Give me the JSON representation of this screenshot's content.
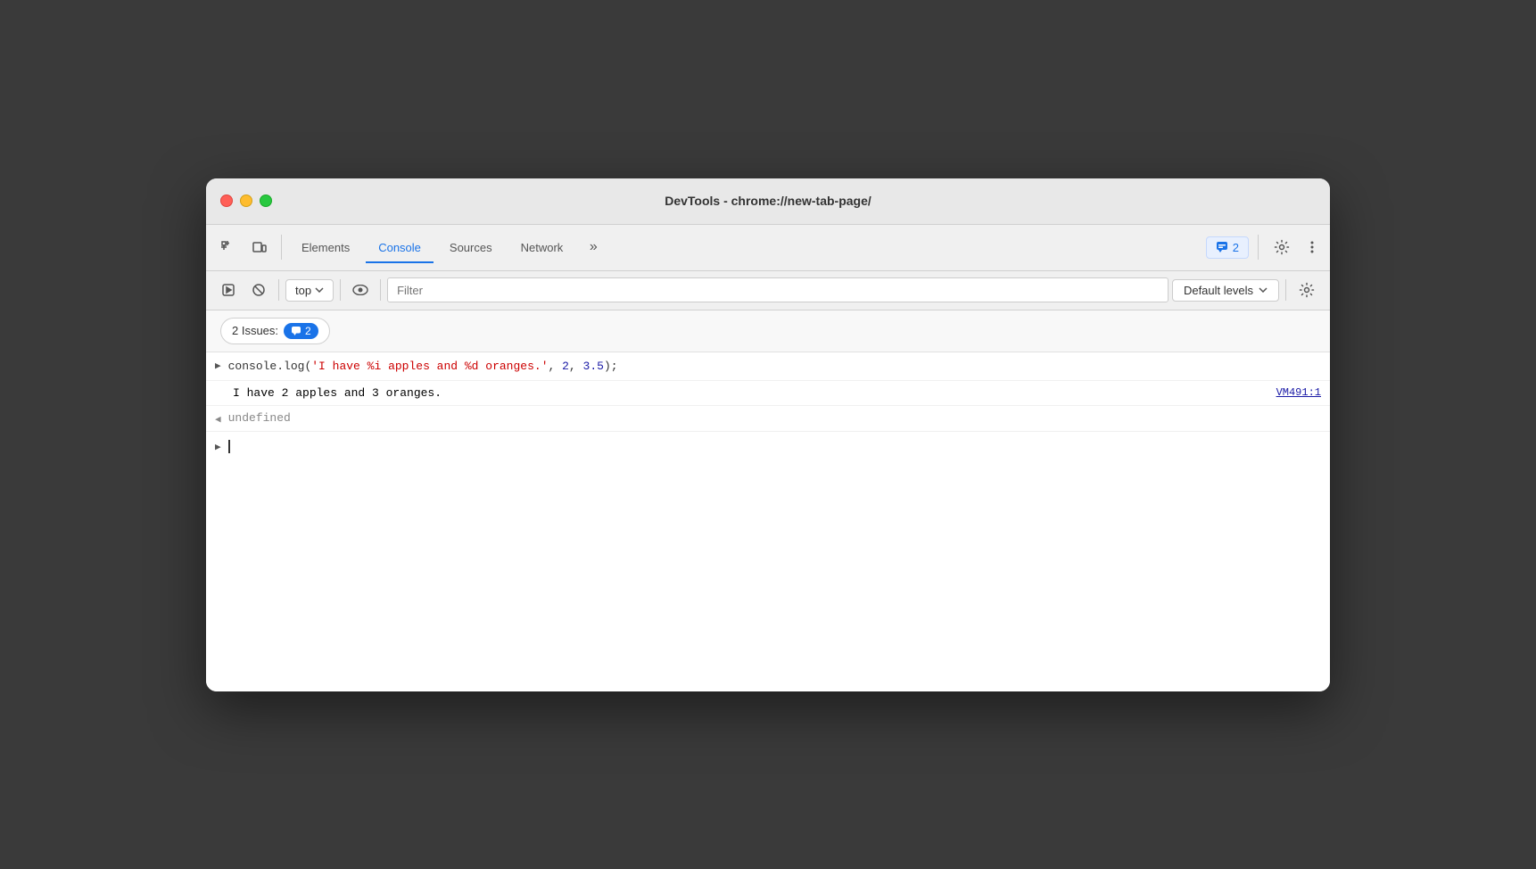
{
  "window": {
    "title": "DevTools - chrome://new-tab-page/"
  },
  "tabs": {
    "items": [
      {
        "id": "elements",
        "label": "Elements",
        "active": false
      },
      {
        "id": "console",
        "label": "Console",
        "active": true
      },
      {
        "id": "sources",
        "label": "Sources",
        "active": false
      },
      {
        "id": "network",
        "label": "Network",
        "active": false
      }
    ],
    "more_label": "»"
  },
  "issues_badge": {
    "count_label": "2",
    "icon": "chat-icon"
  },
  "toolbar": {
    "top_label": "top",
    "filter_placeholder": "Filter",
    "default_levels_label": "Default levels"
  },
  "issues_bar": {
    "prefix": "2 Issues:",
    "count": "2"
  },
  "console": {
    "entry1": {
      "code_prefix": "console.log(",
      "string_part": "'I have %i apples and %d oranges.'",
      "comma1": ", ",
      "num1": "2",
      "comma2": ", ",
      "num2": "3.5",
      "code_suffix": ");"
    },
    "entry2": {
      "text": "I have 2 apples and 3 oranges.",
      "link": "VM491:1"
    },
    "entry3": {
      "text": "undefined"
    }
  }
}
